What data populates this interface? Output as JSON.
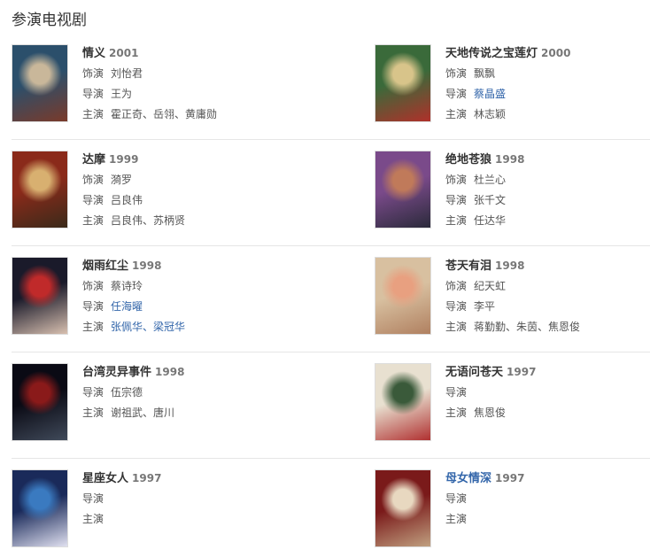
{
  "section": {
    "title": "参演电视剧"
  },
  "labels": {
    "role": "饰演",
    "director": "导演",
    "cast": "主演"
  },
  "rows": [
    {
      "left": {
        "title": "情义",
        "year": "2001",
        "role": "刘怡君",
        "director": "王为",
        "cast": "霍正奇、岳翎、黄庸勋",
        "colors": [
          "#2b4f6b",
          "#c9b79a",
          "#7a3a2a"
        ]
      },
      "right": {
        "title": "天地传说之宝莲灯",
        "year": "2000",
        "role": "飘飘",
        "director": "蔡晶盛",
        "cast": "林志颖",
        "colors": [
          "#3a6a3a",
          "#d8c48a",
          "#b0302a"
        ]
      }
    },
    {
      "left": {
        "title": "达摩",
        "year": "1999",
        "role": "漪罗",
        "director": "吕良伟",
        "cast": "吕良伟、苏柄贤",
        "colors": [
          "#8a2a1a",
          "#d8b070",
          "#3a2a1a"
        ]
      },
      "right": {
        "title": "绝地苍狼",
        "year": "1998",
        "role": "杜兰心",
        "director": "张千文",
        "cast": "任达华",
        "colors": [
          "#7a4a8a",
          "#c07a5a",
          "#2a2a3a"
        ]
      }
    },
    {
      "left": {
        "title": "烟雨红尘",
        "year": "1998",
        "role": "蔡诗玲",
        "director": "任海曜",
        "cast": "张佩华、梁冠华",
        "colors": [
          "#1a1a2a",
          "#c02a2a",
          "#d8c0b0"
        ]
      },
      "right": {
        "title": "苍天有泪",
        "year": "1998",
        "role": "纪天虹",
        "director": "李平",
        "cast": "蒋勤勤、朱茵、焦恩俊",
        "colors": [
          "#d8c0a0",
          "#e8a080",
          "#b08060"
        ]
      }
    },
    {
      "left": {
        "title": "台湾灵异事件",
        "year": "1998",
        "director": "伍宗德",
        "cast": "谢祖武、唐川",
        "colors": [
          "#0a0a14",
          "#8a1a1a",
          "#404a5a"
        ]
      },
      "right": {
        "title": "无语问苍天",
        "year": "1997",
        "director": "",
        "cast": "焦恩俊",
        "colors": [
          "#e8e0d0",
          "#3a5a3a",
          "#b03030"
        ]
      }
    },
    {
      "left": {
        "title": "星座女人",
        "year": "1997",
        "director": "",
        "cast": "",
        "colors": [
          "#1a2a5a",
          "#3a7ac0",
          "#e0e0f0"
        ]
      },
      "right": {
        "title": "母女情深",
        "year": "1997",
        "director": "",
        "cast": "",
        "colors": [
          "#7a1a1a",
          "#e8d8c0",
          "#c0a080"
        ]
      }
    }
  ]
}
